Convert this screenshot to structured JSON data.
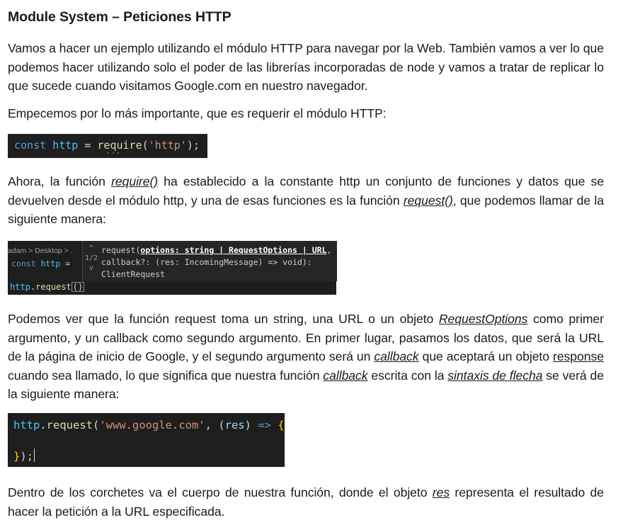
{
  "title": "Module System – Peticiones HTTP",
  "para1": "Vamos a hacer un ejemplo utilizando el módulo HTTP para navegar por la Web. También vamos a ver lo que podemos hacer utilizando solo el poder de las librerías incorporadas de node y vamos a tratar de replicar lo que sucede cuando visitamos Google.com en nuestro navegador.",
  "para2": "Empecemos por lo más importante, que es requerir el módulo HTTP:",
  "code1": {
    "kw": "const",
    "var": "http",
    "eq": " = ",
    "fn": "require",
    "open": "(",
    "str": "'http'",
    "close": ");"
  },
  "para3": {
    "t1": "Ahora, la función ",
    "l1": "require()",
    "t2": " ha establecido a la constante http un conjunto de funciones y datos que se devuelven desde el módulo http, y una de esas funciones es la función ",
    "l2": "request()",
    "t3": ", que podemos llamar de la siguiente manera:"
  },
  "code2": {
    "crumb": "adam > Desktop > .",
    "line2_kw": "const",
    "line2_var": "http",
    "line2_eq": " =",
    "line3_obj": "http",
    "line3_dot": ".",
    "line3_fn": "request",
    "line3_paren": "()",
    "nav_up": "^",
    "nav_count": "1/2",
    "nav_down": "v",
    "sig_l1_a": "request(",
    "sig_l1_b": "options: string | RequestOptions | URL",
    "sig_l1_c": ",",
    "sig_l2": "callback?: (res: IncomingMessage) => void):",
    "sig_l3": "ClientRequest"
  },
  "para4": {
    "t1": "Podemos ver que la función request toma un string, una URL o un objeto ",
    "l1": "RequestOptions",
    "t2": " como primer argumento, y un callback como segundo argumento. En primer lugar, pasamos los datos, que será la URL de la página de inicio de Google, y el segundo argumento será un ",
    "l2": "callback",
    "t3": " que aceptará un objeto ",
    "l3": "response",
    "t4": " cuando sea llamado, lo que significa que nuestra función ",
    "l4": "callback",
    "t5": " escrita con la ",
    "l5": "sintaxis de flecha",
    "t6": " se verá de la siguiente manera:"
  },
  "code3": {
    "obj": "http",
    "dot": ".",
    "fn": "request",
    "open": "(",
    "str": "'www.google.com'",
    "comma": ", ",
    "popen": "(",
    "param": "res",
    "pclose": ")",
    "arrow": " => ",
    "brace": "{",
    "close_brace": "}",
    "close_rest": ");"
  },
  "para5": {
    "t1": "Dentro de los corchetes va el cuerpo de nuestra función, donde el objeto ",
    "l1": "res",
    "t2": " representa el resultado de hacer la petición a la URL especificada."
  },
  "colors": {
    "code_bg": "#1f1f1f",
    "keyword": "#569cd6",
    "variable": "#4fc1ff",
    "function": "#dcdcaa",
    "string": "#ce9178"
  }
}
